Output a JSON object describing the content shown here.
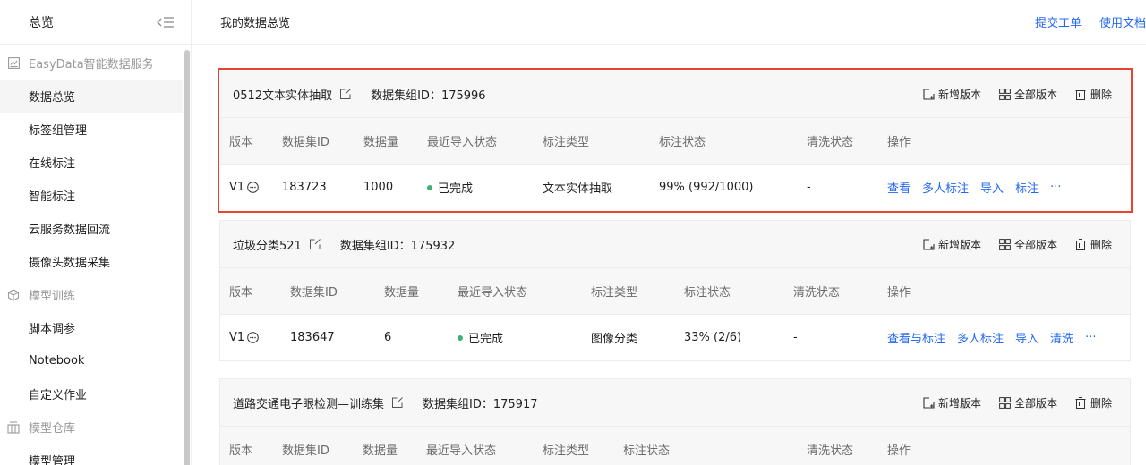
{
  "sidebar": {
    "title": "总览",
    "groups": [
      {
        "label": "EasyData智能数据服务",
        "items": [
          "数据总览",
          "标签组管理",
          "在线标注",
          "智能标注",
          "云服务数据回流",
          "摄像头数据采集"
        ]
      },
      {
        "label": "模型训练",
        "items": [
          "脚本调参",
          "Notebook",
          "自定义作业"
        ]
      },
      {
        "label": "模型仓库",
        "items": [
          "模型管理"
        ]
      }
    ],
    "active_item": "数据总览"
  },
  "header": {
    "title": "我的数据总览",
    "links": [
      "提交工单",
      "使用文档"
    ]
  },
  "card_actions": [
    "新增版本",
    "全部版本",
    "删除"
  ],
  "columns": [
    "版本",
    "数据集ID",
    "数据量",
    "最近导入状态",
    "标注类型",
    "标注状态",
    "清洗状态",
    "操作"
  ],
  "cards": [
    {
      "name": "0512文本实体抽取",
      "group_id": "数据集组ID：175996",
      "row": {
        "version": "V1",
        "dataset_id": "183723",
        "count": "1000",
        "import_status": "已完成",
        "label_type": "文本实体抽取",
        "label_status": "99% (992/1000)",
        "clean_status": "-",
        "ops": [
          "查看",
          "多人标注",
          "导入",
          "标注",
          "···"
        ]
      }
    },
    {
      "name": "垃圾分类521",
      "group_id": "数据集组ID：175932",
      "row": {
        "version": "V1",
        "dataset_id": "183647",
        "count": "6",
        "import_status": "已完成",
        "label_type": "图像分类",
        "label_status": "33% (2/6)",
        "clean_status": "-",
        "ops": [
          "查看与标注",
          "多人标注",
          "导入",
          "清洗",
          "···"
        ]
      }
    },
    {
      "name": "道路交通电子眼检测—训练集",
      "group_id": "数据集组ID：175917"
    }
  ],
  "colors": {
    "accent": "#2468f2",
    "highlight_border": "#e8432d",
    "status_ok": "#3cb371"
  }
}
